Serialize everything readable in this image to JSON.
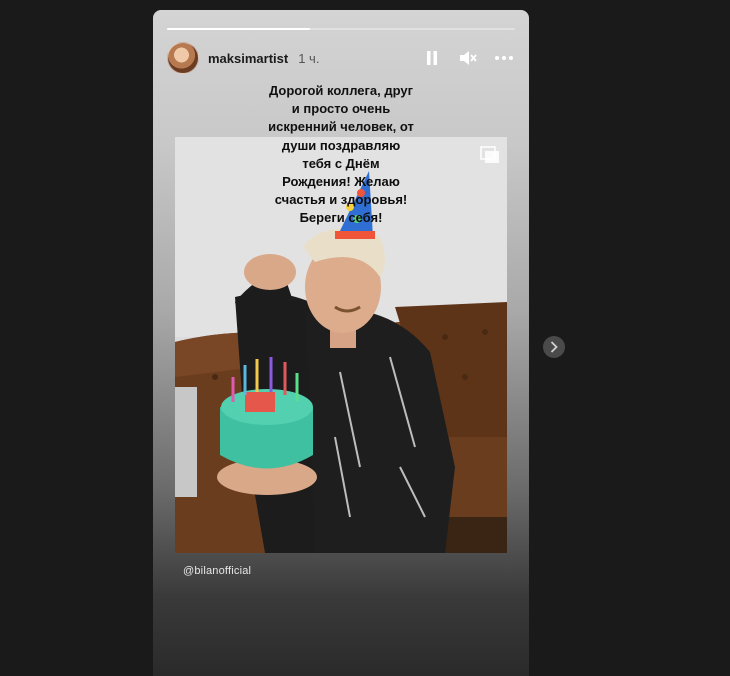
{
  "story": {
    "progress": 0.41,
    "username": "maksimartist",
    "time_ago": "1 ч.",
    "caption_top": [
      "Дорогой коллега, друг",
      "и просто очень",
      "искренний человек, от"
    ],
    "caption_overlay": [
      "души поздравляю",
      "тебя с Днём",
      "Рождения! Желаю",
      "счастья и здоровья!",
      "Береги себя!"
    ],
    "mention": "@bilanofficial"
  },
  "icons": {
    "pause": "pause-icon",
    "mute": "speaker-muted-icon",
    "more": "more-dots-icon",
    "multi": "multiple-photos-icon",
    "next": "chevron-right-icon"
  },
  "colors": {
    "page_bg": "#1a1a1a",
    "hat_blue": "#2f6fd3",
    "cake_teal": "#3fc0a0",
    "sofa_brown": "#6b3d1f"
  }
}
